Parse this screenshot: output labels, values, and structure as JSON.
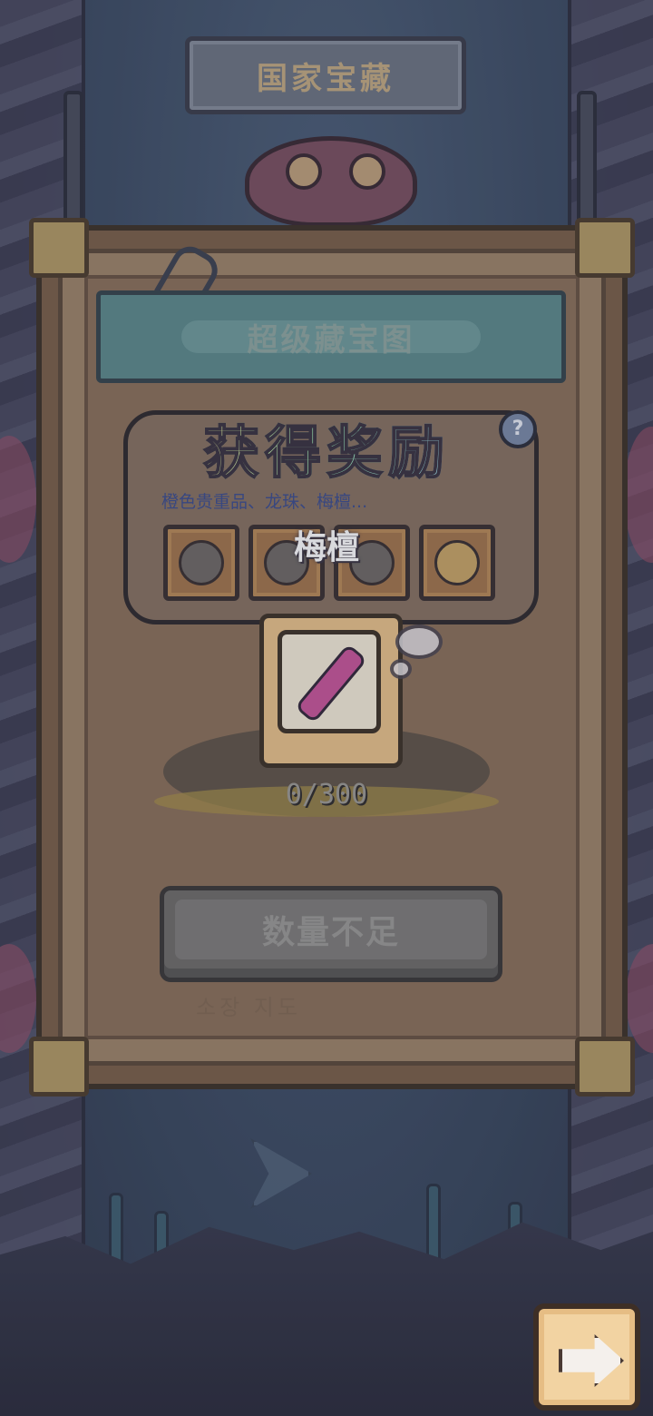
{
  "header": {
    "title": "国家宝藏"
  },
  "map_panel": {
    "title": "超级藏宝图",
    "map_label": "소장 지도"
  },
  "reward_popup": {
    "title": "获得奖励",
    "description": "橙色贵重品、龙珠、梅檀...",
    "reward_name": "梅檀",
    "help_icon": "question-icon",
    "slots": [
      {
        "icon": "helmet-icon"
      },
      {
        "icon": "horn-icon"
      },
      {
        "icon": "sarcophagus-icon"
      },
      {
        "icon": "plate-icon"
      }
    ]
  },
  "treasure": {
    "item_icon": "popsicle-icon",
    "progress_text": "0/300",
    "current": 0,
    "required": 300
  },
  "action_button": {
    "label": "数量不足"
  },
  "navigation": {
    "next_icon": "arrow-right-icon"
  },
  "colors": {
    "background": "#3f4a60",
    "panel": "#7a6048",
    "header_teal": "#5d8a8c",
    "button_disabled": "#6f6d6a",
    "next_button": "#f2d3a2"
  }
}
